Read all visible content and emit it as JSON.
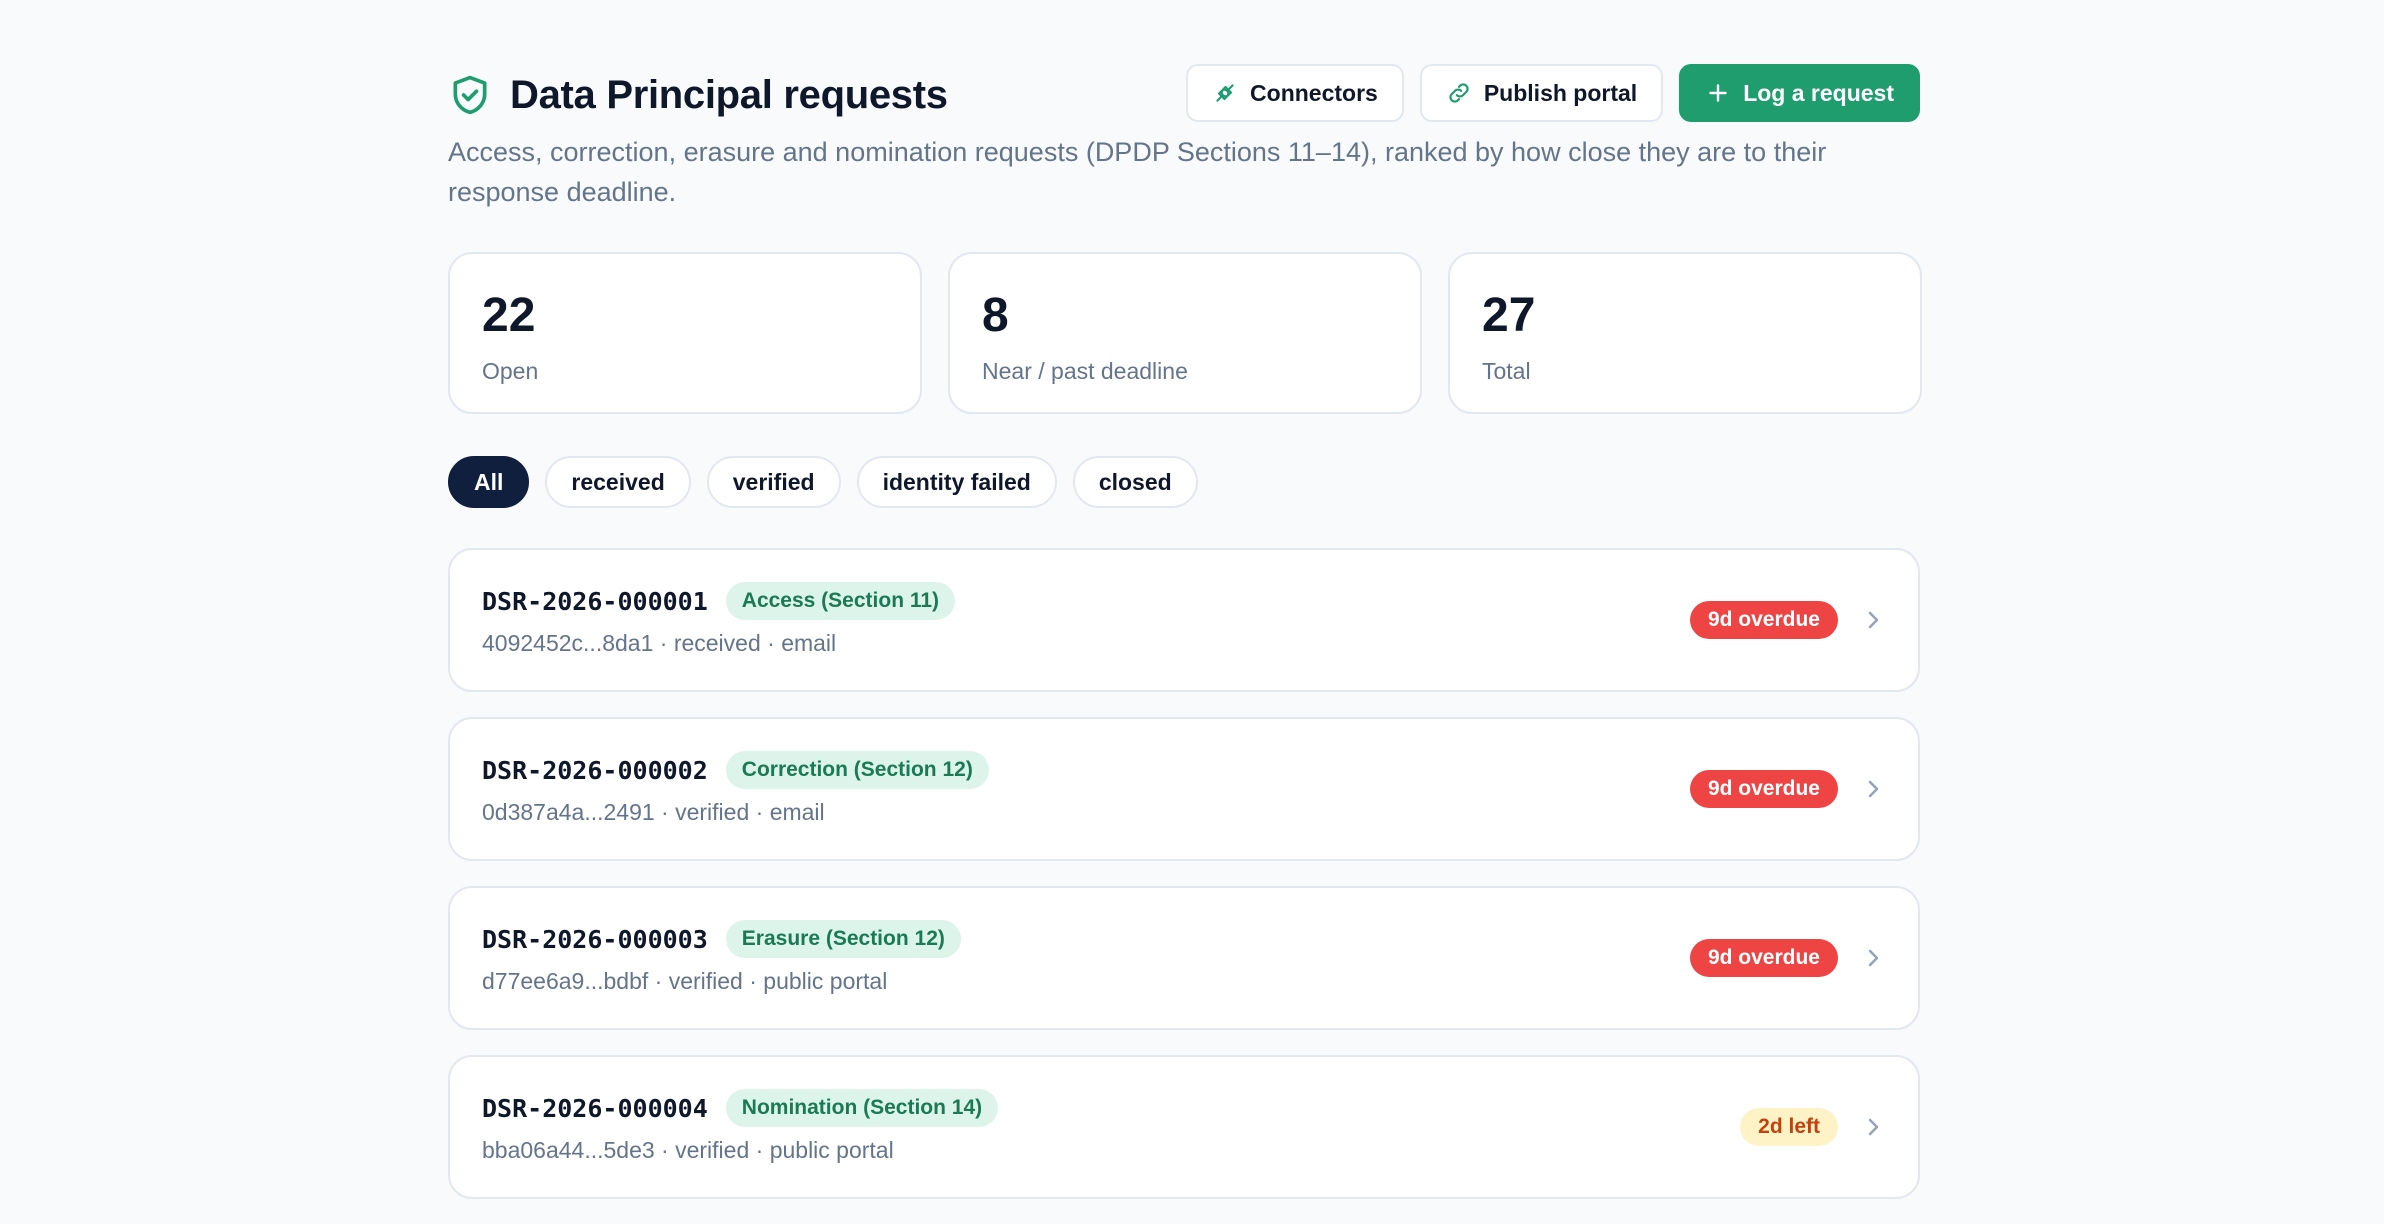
{
  "header": {
    "title": "Data Principal requests",
    "shield_icon": "shield-check-icon",
    "subtitle": "Access, correction, erasure and nomination requests (DPDP Sections 11–14), ranked by how close they are to their response deadline."
  },
  "actions": {
    "connectors_label": "Connectors",
    "connectors_icon": "plug-icon",
    "publish_label": "Publish portal",
    "publish_icon": "link-icon",
    "log_label": "Log a request",
    "log_icon": "plus-icon"
  },
  "stats": [
    {
      "value": "22",
      "label": "Open"
    },
    {
      "value": "8",
      "label": "Near / past deadline"
    },
    {
      "value": "27",
      "label": "Total"
    }
  ],
  "filters": [
    {
      "label": "All",
      "active": true
    },
    {
      "label": "received",
      "active": false
    },
    {
      "label": "verified",
      "active": false
    },
    {
      "label": "identity failed",
      "active": false
    },
    {
      "label": "closed",
      "active": false
    }
  ],
  "requests": [
    {
      "id": "DSR-2026-000001",
      "type": "Access (Section 11)",
      "meta": "4092452c...8da1 · received · email",
      "status": "9d overdue",
      "status_kind": "overdue"
    },
    {
      "id": "DSR-2026-000002",
      "type": "Correction (Section 12)",
      "meta": "0d387a4a...2491 · verified · email",
      "status": "9d overdue",
      "status_kind": "overdue"
    },
    {
      "id": "DSR-2026-000003",
      "type": "Erasure (Section 12)",
      "meta": "d77ee6a9...bdbf · verified · public portal",
      "status": "9d overdue",
      "status_kind": "overdue"
    },
    {
      "id": "DSR-2026-000004",
      "type": "Nomination (Section 14)",
      "meta": "bba06a44...5de3 · verified · public portal",
      "status": "2d left",
      "status_kind": "left"
    }
  ],
  "colors": {
    "accent": "#1f9d6e",
    "overdue": "#ef4444",
    "warning_bg": "#fef3c7",
    "navy": "#0f1f3d"
  }
}
